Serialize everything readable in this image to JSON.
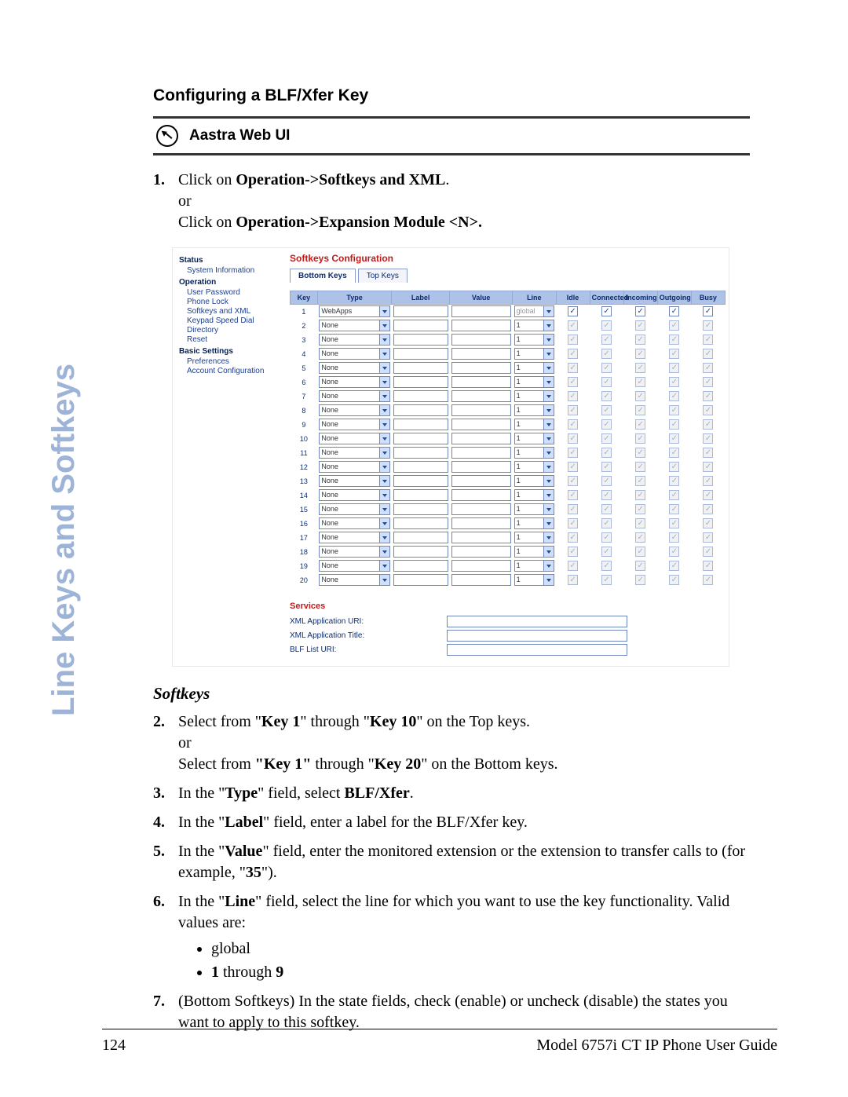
{
  "side_banner": "Line Keys and Softkeys",
  "heading": "Configuring a BLF/Xfer Key",
  "web_ui_label": "Aastra Web UI",
  "step1": {
    "a": "Click on ",
    "b": "Operation->Softkeys and XML",
    "c": ".",
    "or": "or",
    "d": "Click on ",
    "e": "Operation->Expansion Module <N>."
  },
  "webui": {
    "nav": {
      "cat_status": "Status",
      "item_sysinfo": "System Information",
      "cat_operation": "Operation",
      "item_userpw": "User Password",
      "item_phonelock": "Phone Lock",
      "item_softkeys": "Softkeys and XML",
      "item_keypad": "Keypad Speed Dial",
      "item_directory": "Directory",
      "item_reset": "Reset",
      "cat_basic": "Basic Settings",
      "item_pref": "Preferences",
      "item_acct": "Account Configuration"
    },
    "panel_title": "Softkeys Configuration",
    "tabs": {
      "bottom": "Bottom Keys",
      "top": "Top Keys"
    },
    "cols": {
      "key": "Key",
      "type": "Type",
      "label": "Label",
      "value": "Value",
      "line": "Line",
      "idle": "Idle",
      "connected": "Connected",
      "incoming": "Incoming",
      "outgoing": "Outgoing",
      "busy": "Busy"
    },
    "rows": [
      {
        "key": "1",
        "type": "WebApps",
        "line": "global",
        "line_disabled": true,
        "states_disabled": false
      },
      {
        "key": "2",
        "type": "None",
        "line": "1",
        "line_disabled": false,
        "states_disabled": true
      },
      {
        "key": "3",
        "type": "None",
        "line": "1",
        "line_disabled": false,
        "states_disabled": true
      },
      {
        "key": "4",
        "type": "None",
        "line": "1",
        "line_disabled": false,
        "states_disabled": true
      },
      {
        "key": "5",
        "type": "None",
        "line": "1",
        "line_disabled": false,
        "states_disabled": true
      },
      {
        "key": "6",
        "type": "None",
        "line": "1",
        "line_disabled": false,
        "states_disabled": true
      },
      {
        "key": "7",
        "type": "None",
        "line": "1",
        "line_disabled": false,
        "states_disabled": true
      },
      {
        "key": "8",
        "type": "None",
        "line": "1",
        "line_disabled": false,
        "states_disabled": true
      },
      {
        "key": "9",
        "type": "None",
        "line": "1",
        "line_disabled": false,
        "states_disabled": true
      },
      {
        "key": "10",
        "type": "None",
        "line": "1",
        "line_disabled": false,
        "states_disabled": true
      },
      {
        "key": "11",
        "type": "None",
        "line": "1",
        "line_disabled": false,
        "states_disabled": true
      },
      {
        "key": "12",
        "type": "None",
        "line": "1",
        "line_disabled": false,
        "states_disabled": true
      },
      {
        "key": "13",
        "type": "None",
        "line": "1",
        "line_disabled": false,
        "states_disabled": true
      },
      {
        "key": "14",
        "type": "None",
        "line": "1",
        "line_disabled": false,
        "states_disabled": true
      },
      {
        "key": "15",
        "type": "None",
        "line": "1",
        "line_disabled": false,
        "states_disabled": true
      },
      {
        "key": "16",
        "type": "None",
        "line": "1",
        "line_disabled": false,
        "states_disabled": true
      },
      {
        "key": "17",
        "type": "None",
        "line": "1",
        "line_disabled": false,
        "states_disabled": true
      },
      {
        "key": "18",
        "type": "None",
        "line": "1",
        "line_disabled": false,
        "states_disabled": true
      },
      {
        "key": "19",
        "type": "None",
        "line": "1",
        "line_disabled": false,
        "states_disabled": true
      },
      {
        "key": "20",
        "type": "None",
        "line": "1",
        "line_disabled": false,
        "states_disabled": true
      }
    ],
    "services_title": "Services",
    "services": {
      "xml_uri": "XML Application URI:",
      "xml_title": "XML Application Title:",
      "blf_uri": "BLF List URI:"
    }
  },
  "sub_heading": "Softkeys",
  "step2": {
    "a": "Select from \"",
    "b": "Key 1",
    "c": "\" through \"",
    "d": "Key 10",
    "e": "\" on the Top keys.",
    "or": "or",
    "f": "Select from ",
    "g": "\"Key 1\"",
    "h": " through \"",
    "i": "Key 20",
    "j": "\" on the Bottom keys."
  },
  "step3": {
    "a": "In the \"",
    "b": "Type",
    "c": "\" field, select ",
    "d": "BLF/Xfer",
    "e": "."
  },
  "step4": {
    "a": "In the \"",
    "b": "Label",
    "c": "\" field, enter a label for the BLF/Xfer key."
  },
  "step5": {
    "a": "In the \"",
    "b": "Value",
    "c": "\" field, enter the monitored extension or the extension to transfer calls to (for example, \"",
    "d": "35",
    "e": "\")."
  },
  "step6": {
    "a": "In the \"",
    "b": "Line",
    "c": "\" field, select the line for which you want to use the key functionality. Valid values are:"
  },
  "bullets": {
    "b1": "global",
    "b2a": "1",
    "b2b": " through ",
    "b2c": "9"
  },
  "step7": "(Bottom Softkeys) In the state fields, check (enable) or uncheck (disable) the states you want to apply to this softkey.",
  "footer": {
    "page": "124",
    "title": "Model 6757i CT IP Phone User Guide"
  }
}
